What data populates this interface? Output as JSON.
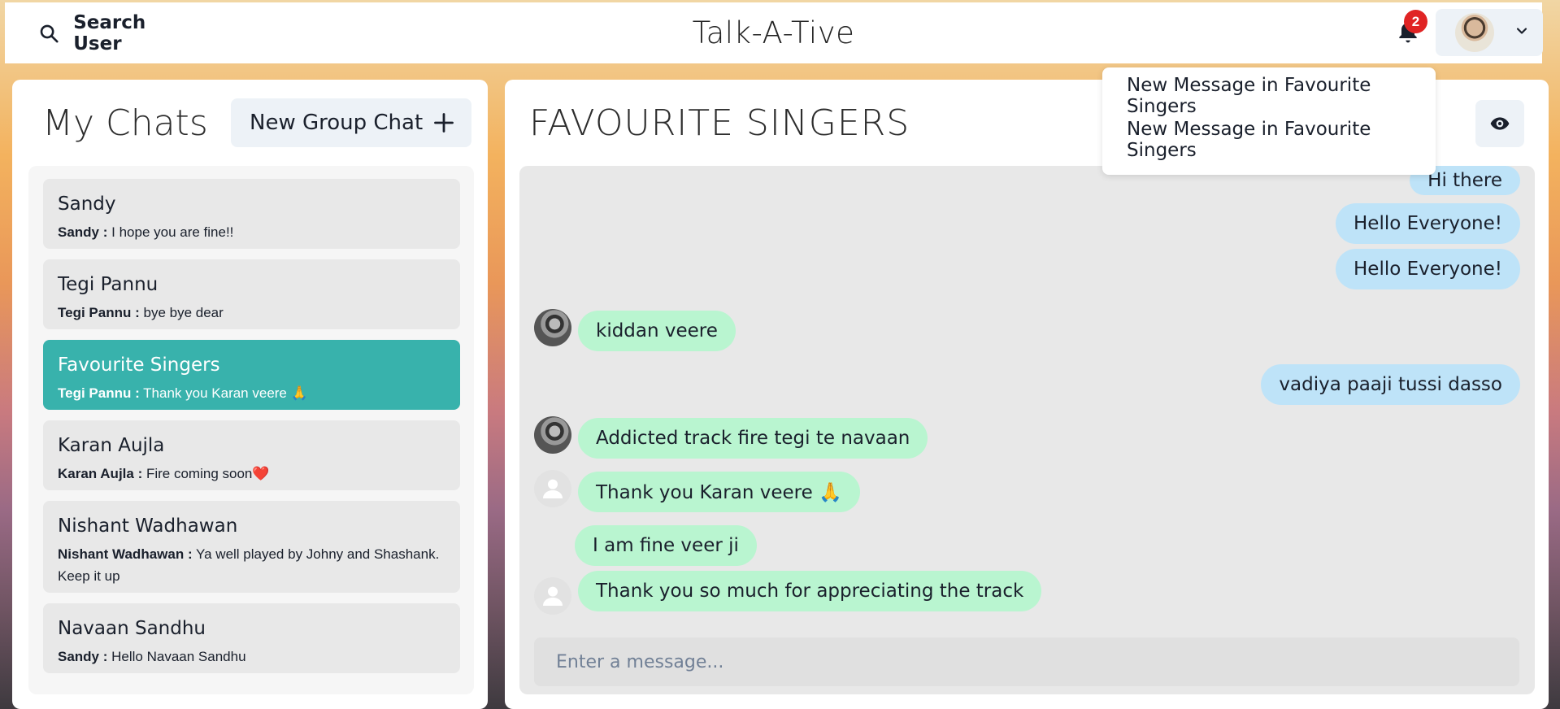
{
  "header": {
    "search_label": "Search User",
    "app_title": "Talk-A-Tive",
    "notification_count": "2"
  },
  "notifications": [
    "New Message in Favourite Singers",
    "New Message in Favourite Singers"
  ],
  "sidebar": {
    "title": "My Chats",
    "new_group_label": "New Group Chat",
    "chats": [
      {
        "name": "Sandy",
        "sender": "Sandy :",
        "preview": "I hope you are fine!!",
        "active": false
      },
      {
        "name": "Tegi Pannu",
        "sender": "Tegi Pannu :",
        "preview": "bye bye dear",
        "active": false
      },
      {
        "name": "Favourite Singers",
        "sender": "Tegi Pannu :",
        "preview": "Thank you Karan veere 🙏",
        "active": true
      },
      {
        "name": "Karan Aujla",
        "sender": "Karan Aujla :",
        "preview": "Fire coming soon❤️",
        "active": false
      },
      {
        "name": "Nishant Wadhawan",
        "sender": "Nishant Wadhawan :",
        "preview": "Ya well played by Johny and Shashank. Keep it up",
        "active": false
      },
      {
        "name": "Navaan Sandhu",
        "sender": "Sandy :",
        "preview": "Hello Navaan Sandhu",
        "active": false
      }
    ]
  },
  "chat": {
    "title": "FAVOURITE SINGERS",
    "messages": [
      {
        "text": "Hi there",
        "mine": true
      },
      {
        "text": "Hello Everyone!",
        "mine": true
      },
      {
        "text": "Hello Everyone!",
        "mine": true
      },
      {
        "text": "kiddan veere",
        "mine": false
      },
      {
        "text": "vadiya paaji tussi dasso",
        "mine": true
      },
      {
        "text": "Addicted track fire tegi te navaan",
        "mine": false
      },
      {
        "text": "Thank you Karan veere 🙏",
        "mine": false
      },
      {
        "text": "I am fine veer ji",
        "mine": false
      },
      {
        "text": "Thank you so much for appreciating the track",
        "mine": false
      }
    ],
    "input_placeholder": "Enter a message..."
  },
  "icons": {
    "search": "search-icon",
    "bell": "bell-icon",
    "chevron": "chevron-down-icon",
    "plus": "plus-icon",
    "eye": "eye-icon",
    "user": "user-icon"
  },
  "colors": {
    "active_chat": "#38b2ac",
    "my_message": "#bee3f8",
    "their_message": "#b9f5d0",
    "badge": "#e02424"
  }
}
